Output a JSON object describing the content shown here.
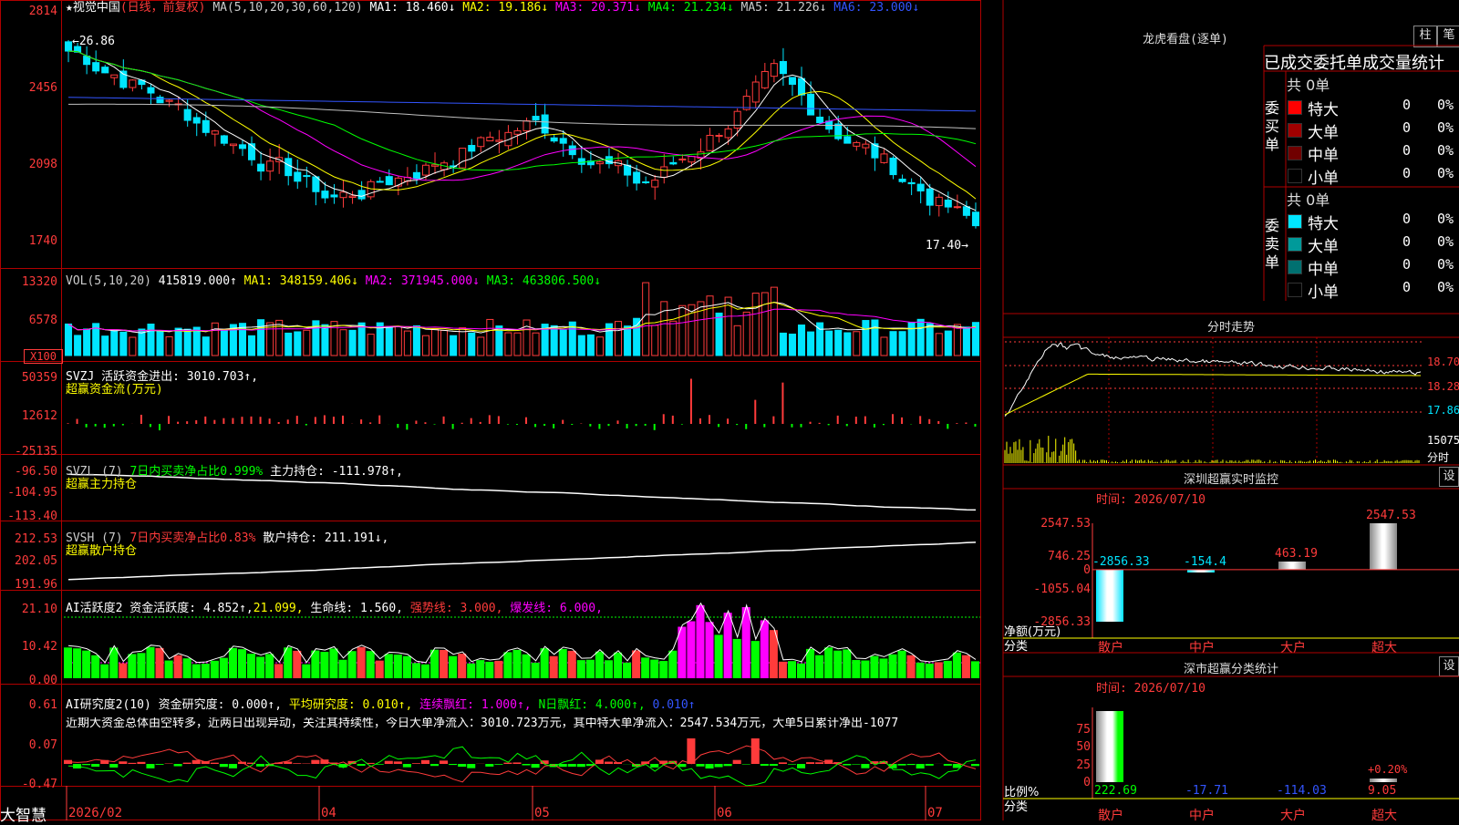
{
  "price_panel": {
    "title_star": "★",
    "stock_name": "视觉中国",
    "mode": "(日线，前复权)",
    "ma_params": "MA(5,10,20,30,60,120)",
    "ma1": "MA1: 18.460↓",
    "ma2": "MA2: 19.186↓",
    "ma3": "MA3: 20.371↓",
    "ma4": "MA4: 21.234↓",
    "ma5": "MA5: 21.226↓",
    "ma6": "MA6: 23.000↓",
    "y_ticks": [
      "2814",
      "2456",
      "2098",
      "1740"
    ],
    "high_label": "←26.86",
    "low_label": "17.40→"
  },
  "vol_panel": {
    "header": "VOL(5,10,20)",
    "vol": "415819.000↑",
    "ma1": "MA1: 348159.406↓",
    "ma2": "MA2: 371945.000↓",
    "ma3": "MA3: 463806.500↓",
    "y_ticks": [
      "13320",
      "6578"
    ],
    "unit": "X100"
  },
  "svzj_panel": {
    "header": "SVZJ  活跃资金进出: 3010.703↑,",
    "sub": "超赢资金流(万元)",
    "y_ticks": [
      "50359",
      "12612",
      "-25135"
    ]
  },
  "svzl_panel": {
    "header1": "SVZL (7) ",
    "header2": "7日内买卖净占比0.999%",
    "header3": " 主力持仓: -111.978↑,",
    "sub": "超赢主力持仓",
    "y_ticks": [
      "-96.50",
      "-104.95",
      "-113.40"
    ]
  },
  "svsh_panel": {
    "header1": "SVSH (7) ",
    "header2": "7日内买卖净占比0.83%",
    "header3": " 散户持仓: 211.191↓,",
    "sub": "超赢散户持仓",
    "y_ticks": [
      "212.53",
      "202.05",
      "191.96"
    ]
  },
  "ai_active_panel": {
    "header1": "AI活跃度2 资金活跃度: 4.852↑,",
    "header2": "21.099,",
    "header3": " 生命线: 1.560,",
    "header4": " 强势线: 3.000,",
    "header5": " 爆发线: 6.000,",
    "y_ticks": [
      "21.10",
      "10.42",
      "0.00"
    ]
  },
  "ai_research_panel": {
    "header1": "AI研究度2(10) 资金研究度: 0.000↑,",
    "header2": " 平均研究度: 0.010↑,",
    "header3": " 连续飘红: 1.000↑,",
    "header4": " N日飘红: 4.000↑,",
    "header5": " 0.010↑",
    "comment": "近期大资金总体由空转多，近两日出现异动，关注其持续性，今日大单净流入：3010.723万元，其中特大单净流入：2547.534万元，大单5日累计净出-1077",
    "y_ticks": [
      "0.61",
      "0.07",
      "-0.47"
    ]
  },
  "x_axis": {
    "brand": "大智慧",
    "labels": [
      "2026/02",
      "04",
      "05",
      "06",
      "07"
    ]
  },
  "right_panel": {
    "dragon_title": "龙虎看盘(逐单)",
    "btn_bar": "柱",
    "btn_pen": "笔",
    "stat_title": "已成交委托单成交量统计",
    "buy_side": {
      "label": "委买单",
      "total": "共 0单",
      "rows": [
        {
          "name": "特大",
          "count": "0",
          "pct": "0%",
          "color": "#ff0000"
        },
        {
          "name": "大单",
          "count": "0",
          "pct": "0%",
          "color": "#a00000"
        },
        {
          "name": "中单",
          "count": "0",
          "pct": "0%",
          "color": "#700000"
        },
        {
          "name": "小单",
          "count": "0",
          "pct": "0%",
          "color": "#000000"
        }
      ]
    },
    "sell_side": {
      "label": "委卖单",
      "total": "共 0单",
      "rows": [
        {
          "name": "特大",
          "count": "0",
          "pct": "0%",
          "color": "#00e5ff"
        },
        {
          "name": "大单",
          "count": "0",
          "pct": "0%",
          "color": "#009a9a"
        },
        {
          "name": "中单",
          "count": "0",
          "pct": "0%",
          "color": "#007070"
        },
        {
          "name": "小单",
          "count": "0",
          "pct": "0%",
          "color": "#000000"
        }
      ]
    },
    "intraday": {
      "title": "分时走势",
      "p1": "18.70",
      "p2": "18.28",
      "p3": "17.86",
      "vol": "15075",
      "vol_unit": "分时"
    },
    "monitor": {
      "title": "深圳超赢实时监控",
      "btn": "设",
      "time": "时间: 2026/07/10",
      "y_ticks": [
        "2547.53",
        "746.25",
        "0",
        "-1055.04",
        "-2856.33"
      ],
      "axis_label1": "净额(万元)",
      "axis_label2": "分类",
      "cats": [
        "散户",
        "中户",
        "大户",
        "超大"
      ],
      "values": [
        -2856.33,
        -154.4,
        463.19,
        2547.53
      ],
      "value_labels": [
        "-2856.33",
        "-154.4",
        "463.19",
        "2547.53"
      ]
    },
    "classify": {
      "title": "深市超赢分类统计",
      "btn": "设",
      "time": "时间: 2026/07/10",
      "y_ticks": [
        "75",
        "50",
        "25",
        "0"
      ],
      "axis_label1": "比例%",
      "axis_label2": "分类",
      "cats": [
        "散户",
        "中户",
        "大户",
        "超大"
      ],
      "bar_values": [
        100,
        0,
        0,
        5
      ],
      "value_labels": [
        "222.69",
        "-17.71",
        "-114.03",
        "9.05"
      ],
      "extra_label": "+0.20%"
    }
  }
}
